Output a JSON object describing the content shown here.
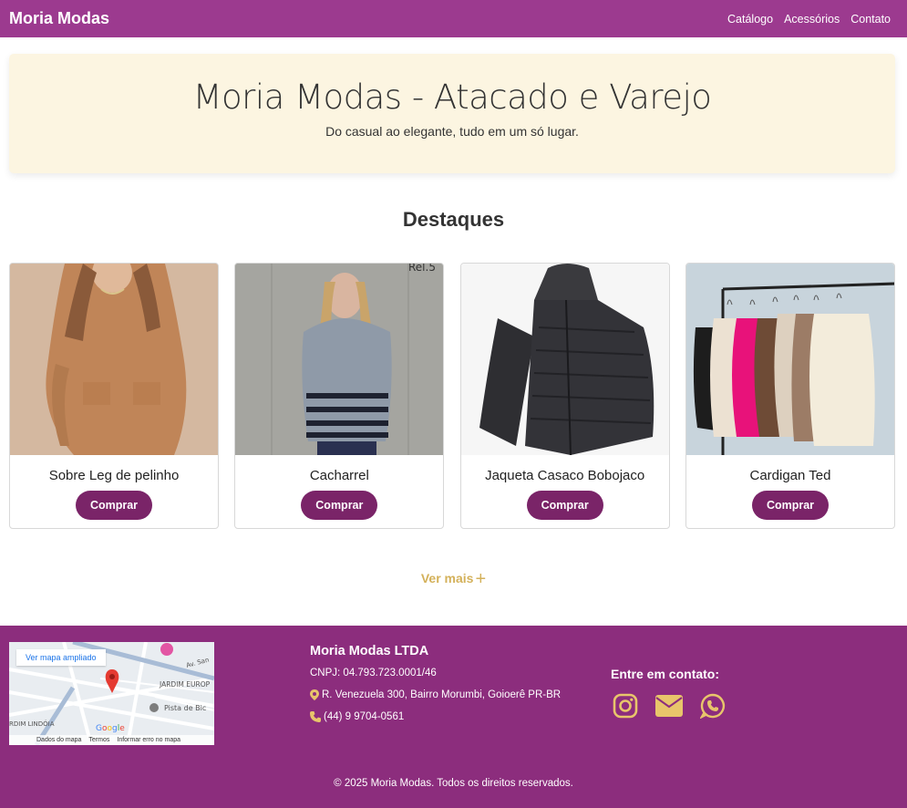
{
  "navbar": {
    "brand": "Moria Modas",
    "links": [
      "Catálogo",
      "Acessórios",
      "Contato"
    ]
  },
  "hero": {
    "title": "Moria Modas - Atacado e Varejo",
    "subtitle": "Do casual ao elegante, tudo em um só lugar."
  },
  "featured": {
    "title": "Destaques",
    "products": [
      {
        "name": "Sobre Leg de pelinho",
        "button": "Comprar"
      },
      {
        "name": "Cacharrel",
        "button": "Comprar"
      },
      {
        "name": "Jaqueta Casaco Bobojaco",
        "button": "Comprar"
      },
      {
        "name": "Cardigan Ted",
        "button": "Comprar"
      }
    ],
    "more_label": "Ver mais"
  },
  "footer": {
    "map": {
      "link_label": "Ver mapa ampliado",
      "attribution": [
        "Dados do mapa",
        "Termos",
        "Informar erro no mapa"
      ]
    },
    "company_name": "Moria Modas LTDA",
    "cnpj": "CNPJ: 04.793.723.0001/46",
    "address": "R. Venezuela 300, Bairro Morumbi, Goioerê PR-BR",
    "phone": "(44) 9 9704-0561",
    "contact_title": "Entre em contato:",
    "social_icons": [
      "instagram-icon",
      "envelope-icon",
      "whatsapp-icon"
    ],
    "copyright": "© 2025 Moria Modas. Todos os direitos reservados."
  },
  "colors": {
    "navbar": "#9c3a8f",
    "footer": "#8c2d7d",
    "button": "#7a2468",
    "hero_bg": "#fcf5e1",
    "accent_gold": "#d4b15a"
  }
}
